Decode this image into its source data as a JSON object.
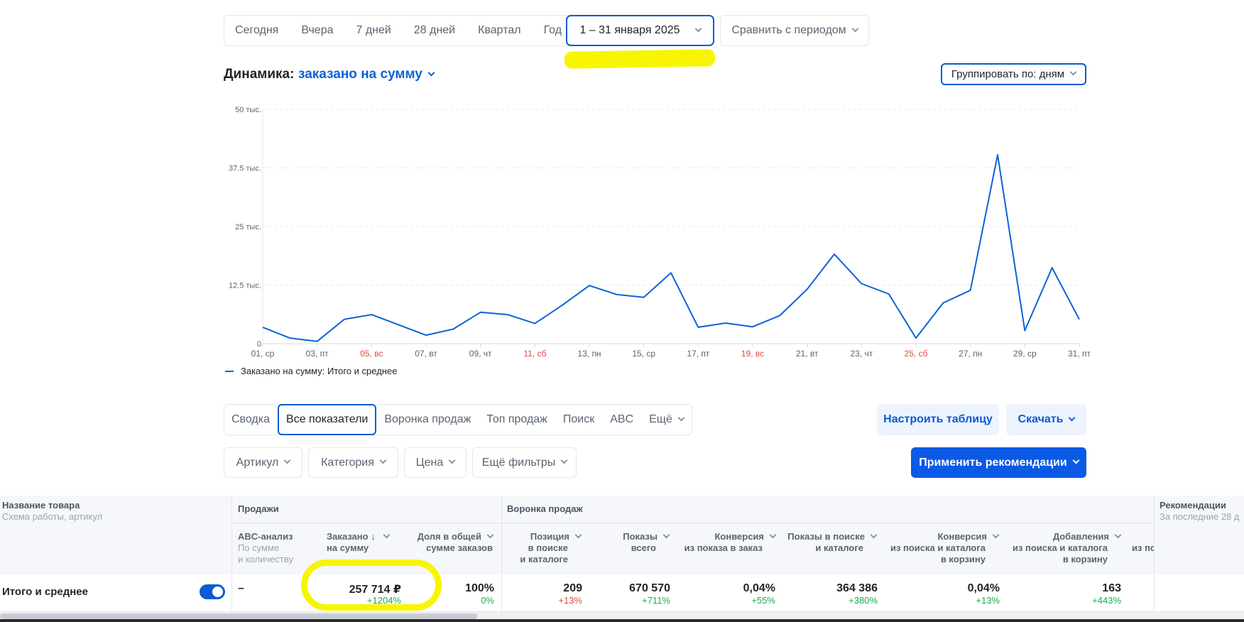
{
  "period": {
    "options": [
      "Сегодня",
      "Вчера",
      "7 дней",
      "28 дней",
      "Квартал",
      "Год"
    ],
    "date_range": "1 – 31 января 2025",
    "compare": "Сравнить с периодом"
  },
  "dynamics": {
    "title": "Динамика:",
    "metric": "заказано на сумму",
    "group_by": "Группировать по: дням",
    "legend": "Заказано на сумму: Итого и среднее"
  },
  "chart_data": {
    "type": "line",
    "title": "",
    "xlabel": "",
    "ylabel": "",
    "ylim": [
      0,
      50000
    ],
    "yticks": [
      {
        "value": 0,
        "label": "0"
      },
      {
        "value": 12500,
        "label": "12.5 тыс."
      },
      {
        "value": 25000,
        "label": "25 тыс."
      },
      {
        "value": 37500,
        "label": "37.5 тыс."
      },
      {
        "value": 50000,
        "label": "50 тыс."
      }
    ],
    "xticks": [
      {
        "day": 1,
        "label": "01, ср",
        "weekend": false
      },
      {
        "day": 3,
        "label": "03, пт",
        "weekend": false
      },
      {
        "day": 5,
        "label": "05, вс",
        "weekend": true
      },
      {
        "day": 7,
        "label": "07, вт",
        "weekend": false
      },
      {
        "day": 9,
        "label": "09, чт",
        "weekend": false
      },
      {
        "day": 11,
        "label": "11, сб",
        "weekend": true
      },
      {
        "day": 13,
        "label": "13, пн",
        "weekend": false
      },
      {
        "day": 15,
        "label": "15, ср",
        "weekend": false
      },
      {
        "day": 17,
        "label": "17, пт",
        "weekend": false
      },
      {
        "day": 19,
        "label": "19, вс",
        "weekend": true
      },
      {
        "day": 21,
        "label": "21, вт",
        "weekend": false
      },
      {
        "day": 23,
        "label": "23, чт",
        "weekend": false
      },
      {
        "day": 25,
        "label": "25, сб",
        "weekend": true
      },
      {
        "day": 27,
        "label": "27, пн",
        "weekend": false
      },
      {
        "day": 29,
        "label": "29, ср",
        "weekend": false
      },
      {
        "day": 31,
        "label": "31, пт",
        "weekend": false
      }
    ],
    "grid": true,
    "series": [
      {
        "name": "Заказано на сумму: Итого и среднее",
        "x": [
          1,
          2,
          3,
          4,
          5,
          6,
          7,
          8,
          9,
          10,
          11,
          12,
          13,
          14,
          15,
          16,
          17,
          18,
          19,
          20,
          21,
          22,
          23,
          24,
          25,
          26,
          27,
          28,
          29,
          30,
          31
        ],
        "values": [
          3500,
          1200,
          500,
          5200,
          6200,
          4000,
          1800,
          3100,
          6700,
          6200,
          4300,
          8200,
          12400,
          10500,
          9900,
          15100,
          3500,
          4400,
          3600,
          6000,
          11600,
          19100,
          12800,
          10600,
          1200,
          8700,
          11400,
          40300,
          2800,
          16200,
          5200
        ]
      }
    ],
    "colors": {
      "line": "#0b63d8",
      "weekend_label": "#e34a3b"
    }
  },
  "report_tabs": [
    "Сводка",
    "Все показатели",
    "Воронка продаж",
    "Топ продаж",
    "Поиск",
    "ABC",
    "Ещё"
  ],
  "buttons": {
    "configure": "Настроить таблицу",
    "download": "Скачать",
    "apply": "Применить рекомендации"
  },
  "filters": [
    "Артикул",
    "Категория",
    "Цена",
    "Ещё фильтры"
  ],
  "table": {
    "name_header": "Название товара",
    "name_sub": "Схема работы, артикул",
    "group_sales": "Продажи",
    "group_funnel": "Воронка продаж",
    "group_reco": "Рекомендации",
    "group_reco_sub": "За последние 28 д",
    "columns": [
      {
        "title": "ABC-анализ",
        "sub1": "По сумме",
        "sub2": "и количеству"
      },
      {
        "title1": "Заказано",
        "title2": "на сумму"
      },
      {
        "title1": "Доля в общей",
        "title2": "сумме заказов"
      },
      {
        "title1": "Позиция",
        "title2": "в поиске",
        "title3": "и каталоге"
      },
      {
        "title1": "Показы",
        "title2": "всего"
      },
      {
        "title1": "Конверсия",
        "title2": "из показа в заказ"
      },
      {
        "title1": "Показы в поиске",
        "title2": "и каталоге"
      },
      {
        "title1": "Конверсия",
        "title2": "из поиска и каталога",
        "title3": "в корзину"
      },
      {
        "title1": "Добавления",
        "title2": "из поиска и каталога",
        "title3": "в корзину"
      },
      {
        "title2": "из по"
      }
    ],
    "total_row": {
      "label": "Итого и среднее",
      "abc": "–",
      "ordered_sum": "257 714 ₽",
      "ordered_sum_delta": "+1204%",
      "share": "100%",
      "share_delta": "0%",
      "position": "209",
      "position_delta": "+13%",
      "views": "670 570",
      "views_delta": "+711%",
      "conversion": "0,04%",
      "conversion_delta": "+55%",
      "search_views": "364 386",
      "search_views_delta": "+380%",
      "cart_conversion": "0,04%",
      "cart_conversion_delta": "+13%",
      "cart_adds": "163",
      "cart_adds_delta": "+443%"
    }
  }
}
